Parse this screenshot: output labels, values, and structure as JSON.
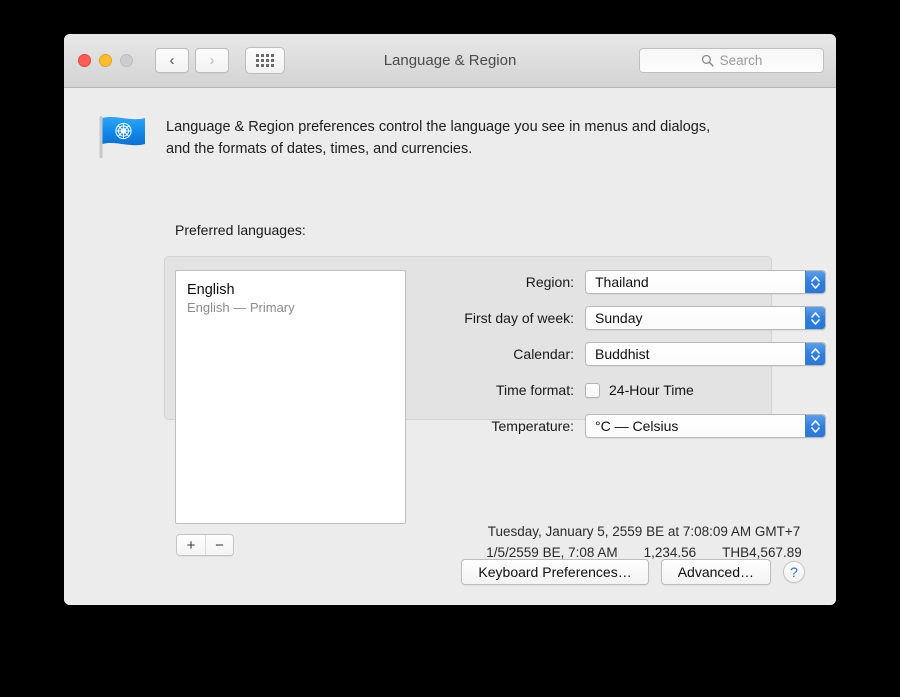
{
  "window": {
    "title": "Language & Region",
    "traffic_lights": {
      "close_color": "#ff5f57",
      "minimize_color": "#ffbd2e",
      "zoom_color": "#cdcdcd"
    },
    "toolbar": {
      "back_glyph": "‹",
      "forward_glyph": "›",
      "show_all_label": "show-all-grid"
    },
    "search": {
      "placeholder": "Search",
      "value": ""
    }
  },
  "header": {
    "icon": "un-flag-icon",
    "description_line1": "Language & Region preferences control the language you see in menus and dialogs,",
    "description_line2": "and the formats of dates, times, and currencies."
  },
  "languages": {
    "group_label": "Preferred languages:",
    "items": [
      {
        "name": "English",
        "detail": "English — Primary"
      }
    ],
    "add_label": "+",
    "remove_label": "−"
  },
  "settings": {
    "rows": [
      {
        "label": "Region:",
        "value": "Thailand"
      },
      {
        "label": "First day of week:",
        "value": "Sunday"
      },
      {
        "label": "Calendar:",
        "value": "Buddhist"
      }
    ],
    "time_format": {
      "label": "Time format:",
      "checkbox_label": "24-Hour Time",
      "checked": false
    },
    "temperature": {
      "label": "Temperature:",
      "value": "°C — Celsius"
    }
  },
  "preview": {
    "long_date": "Tuesday, January 5, 2559 BE at 7:08:09 AM GMT+7",
    "short_date": "1/5/2559 BE, 7:08 AM",
    "number": "1,234.56",
    "currency": "THB4,567.89"
  },
  "footer": {
    "keyboard_button": "Keyboard Preferences…",
    "advanced_button": "Advanced…",
    "help_button": "?"
  },
  "colors": {
    "accent_blue": "#2f7fe0",
    "window_bg": "#ececec",
    "group_bg": "#e3e3e3",
    "help_blue": "#2c6ed5"
  }
}
